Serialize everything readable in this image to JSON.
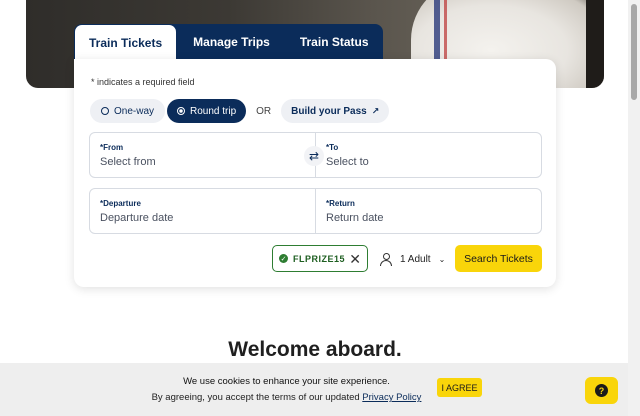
{
  "tabs": [
    {
      "label": "Train Tickets"
    },
    {
      "label": "Manage Trips"
    },
    {
      "label": "Train Status"
    }
  ],
  "form": {
    "required_note": "* indicates a required field",
    "trip_type": {
      "one_way": "One-way",
      "round_trip": "Round trip",
      "selected": "Round trip"
    },
    "or_label": "OR",
    "build_pass": "Build your Pass",
    "from": {
      "label": "*From",
      "placeholder": "Select from"
    },
    "to": {
      "label": "*To",
      "placeholder": "Select to"
    },
    "departure": {
      "label": "*Departure",
      "placeholder": "Departure date"
    },
    "return": {
      "label": "*Return",
      "placeholder": "Return date"
    },
    "promo_code": "FLPRIZE15",
    "passengers": "1 Adult",
    "search_button": "Search Tickets"
  },
  "welcome": "Welcome aboard.",
  "cookie": {
    "line1": "We use cookies to enhance your site experience.",
    "line2_prefix": "By agreeing, you accept the terms of our updated",
    "policy_link": "Privacy Policy",
    "agree_button": "I AGREE"
  },
  "icons": {
    "swap": "swap-icon",
    "external": "external-link-icon",
    "check": "check-circle-icon",
    "clear": "close-icon",
    "person": "person-icon",
    "chevron": "chevron-down-icon",
    "help": "help-icon"
  },
  "colors": {
    "navy": "#0b2c5a",
    "yellow": "#f9d50a",
    "green": "#2e7d32"
  }
}
